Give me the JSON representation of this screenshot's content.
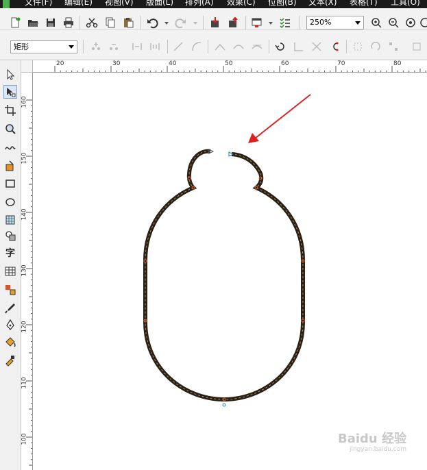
{
  "menu": {
    "items": [
      "文件(F)",
      "编辑(E)",
      "视图(V)",
      "版面(L)",
      "排列(A)",
      "效果(C)",
      "位图(B)",
      "文本(X)",
      "表格(T)",
      "工具(O)"
    ]
  },
  "toolbar": {
    "zoom_value": "250%"
  },
  "property_bar": {
    "shape_value": "矩形"
  },
  "rulers": {
    "horizontal_labels": [
      "20",
      "30",
      "40",
      "50",
      "60",
      "70",
      "80"
    ],
    "vertical_labels": [
      "160",
      "150",
      "140",
      "130",
      "120",
      "110",
      "100"
    ]
  },
  "toolbox": {
    "text_tool_label": "字"
  },
  "watermark": {
    "title": "Baidu 经验",
    "sub": "jingyan.baidu.com"
  },
  "colors": {
    "menubar": "#1a1a1a",
    "path_stroke": "#2a2118",
    "path_dash": "#c8a060",
    "node": "#e06030",
    "arrow": "#e02020",
    "accent": "#7da2ce"
  }
}
